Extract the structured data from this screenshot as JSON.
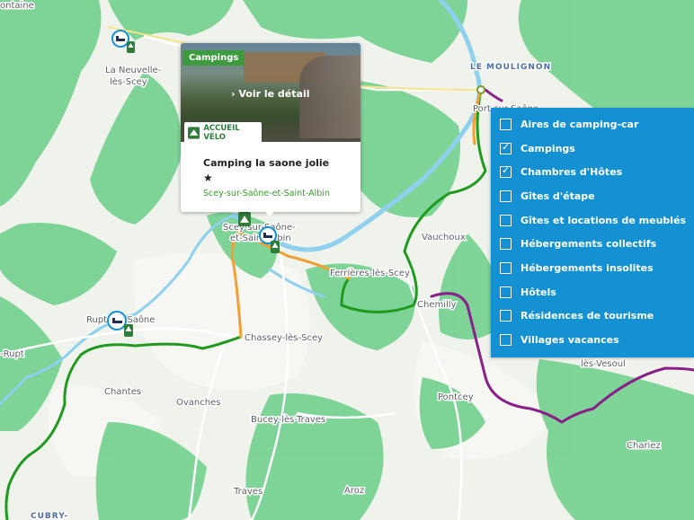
{
  "map": {
    "town_labels": [
      "La Neuvelle-",
      "lès-Scey",
      "LE MOULIGNON",
      "Vauchoux",
      "Ferrières-lès-Scey",
      "Chemilly",
      "Rupt-sur-Saône",
      "Chassey-lès-Scey",
      "-Rupt",
      "Chantes",
      "Ovanches",
      "Bucey-lès-Traves",
      "Pontcey",
      "Chariez",
      "Traves",
      "Aroz",
      "CUBRY-",
      "ontaine",
      "lès-Vesoul",
      "Port-sur-Saône",
      "Scey-sur-Saône-",
      "et-Saint-Albin"
    ],
    "route_colors": {
      "green": "#1e9a1e",
      "orange": "#f2a033",
      "purple": "#8a1f8a",
      "water": "#8fd0ee",
      "forest": "#6ccf8a"
    }
  },
  "popup": {
    "category": "Campings",
    "link": "Voir le détail",
    "badge": "ACCUEIL VÉLO",
    "title": "Camping la saone jolie",
    "stars": "★",
    "location": "Scey-sur-Saône-et-Saint-Albin"
  },
  "filters": [
    {
      "label": "Aires de camping-car",
      "checked": false
    },
    {
      "label": "Campings",
      "checked": true
    },
    {
      "label": "Chambres d'Hôtes",
      "checked": true
    },
    {
      "label": "Gîtes d'étape",
      "checked": false
    },
    {
      "label": "Gîtes et locations de meublés",
      "checked": false
    },
    {
      "label": "Hébergements collectifs",
      "checked": false
    },
    {
      "label": "Hébergements insolites",
      "checked": false
    },
    {
      "label": "Hôtels",
      "checked": false
    },
    {
      "label": "Résidences de tourisme",
      "checked": false
    },
    {
      "label": "Villages vacances",
      "checked": false
    }
  ],
  "check_glyph": "✓"
}
